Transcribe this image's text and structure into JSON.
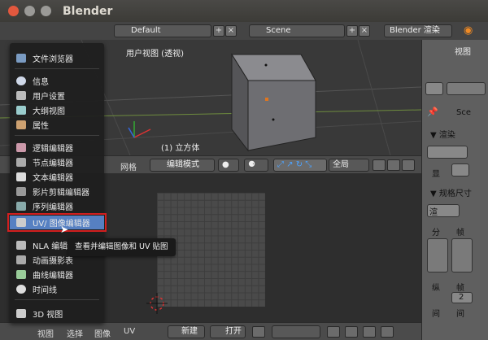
{
  "window": {
    "title": "Blender"
  },
  "topbar": {
    "layout_value": "Default",
    "scene_value": "Scene",
    "engine_value": "Blender 渲染"
  },
  "viewport": {
    "view_label": "用户视图 (透视)",
    "object_label": "(1) 立方体"
  },
  "viewport_header": {
    "mesh_label": "网格",
    "mode_value": "编辑模式",
    "global_value": "全局"
  },
  "editor_menu": {
    "items": [
      {
        "label": "文件浏览器",
        "icon": "file-browser-icon"
      },
      {
        "label": "信息",
        "icon": "info-icon"
      },
      {
        "label": "用户设置",
        "icon": "user-prefs-icon"
      },
      {
        "label": "大纲视图",
        "icon": "outliner-icon"
      },
      {
        "label": "属性",
        "icon": "properties-icon"
      },
      {
        "label": "逻辑编辑器",
        "icon": "logic-editor-icon"
      },
      {
        "label": "节点编辑器",
        "icon": "node-editor-icon"
      },
      {
        "label": "文本编辑器",
        "icon": "text-editor-icon"
      },
      {
        "label": "影片剪辑编辑器",
        "icon": "movie-clip-icon"
      },
      {
        "label": "序列编辑器",
        "icon": "sequencer-icon"
      },
      {
        "label": "UV/ 图像编辑器",
        "icon": "uv-image-icon"
      },
      {
        "label": "NLA 编辑器",
        "icon": "nla-icon"
      },
      {
        "label": "动画摄影表",
        "icon": "dopesheet-icon"
      },
      {
        "label": "曲线编辑器",
        "icon": "graph-editor-icon"
      },
      {
        "label": "时间线",
        "icon": "timeline-icon"
      },
      {
        "label": "3D 视图",
        "icon": "view3d-icon"
      }
    ]
  },
  "tooltip": {
    "text": "查看并编辑图像和 UV 贴图"
  },
  "bottombar": {
    "view": "视图",
    "select": "选择",
    "image": "图像",
    "uv": "UV",
    "new": "新建",
    "open": "打开"
  },
  "rightpanel": {
    "view": "视图",
    "scene_short": "Sce",
    "render": "▼ 渲染",
    "display": "显",
    "dimensions": "▼ 规格尺寸",
    "render_short": "渲",
    "fen": "分",
    "zhen": "帧",
    "zong": "纵",
    "zhen2": "帧",
    "two": "2",
    "jian": "间",
    "jian2": "间"
  },
  "colors": {
    "highlight": "#5680c2",
    "red_outline": "#d21f1f"
  }
}
